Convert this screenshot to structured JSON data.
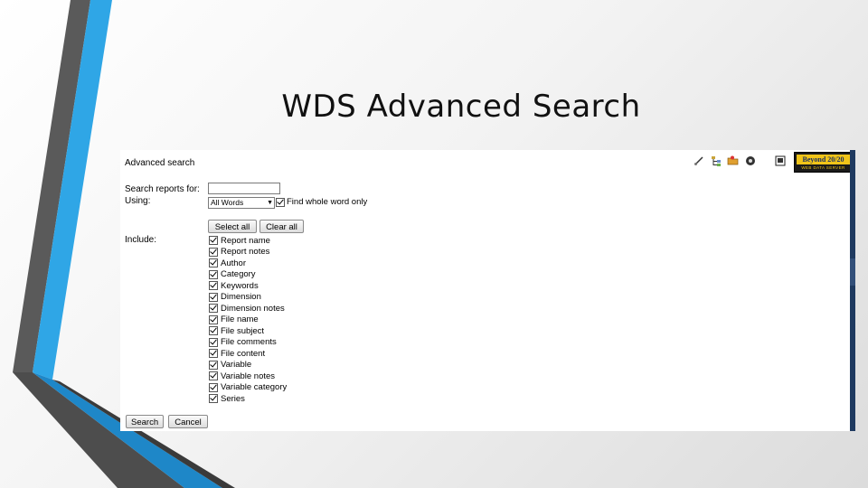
{
  "slide": {
    "title": "WDS Advanced Search"
  },
  "page": {
    "heading": "Advanced search",
    "search_label": "Search reports for:",
    "search_value": "",
    "using_label": "Using:",
    "using_selected": "All Words",
    "whole_word_label": "Find whole word only",
    "whole_word_checked": true,
    "select_all_label": "Select all",
    "clear_all_label": "Clear all",
    "include_label": "Include:",
    "include_items": [
      {
        "label": "Report name",
        "checked": true
      },
      {
        "label": "Report notes",
        "checked": true
      },
      {
        "label": "Author",
        "checked": true
      },
      {
        "label": "Category",
        "checked": true
      },
      {
        "label": "Keywords",
        "checked": true
      },
      {
        "label": "Dimension",
        "checked": true
      },
      {
        "label": "Dimension notes",
        "checked": true
      },
      {
        "label": "File name",
        "checked": true
      },
      {
        "label": "File subject",
        "checked": true
      },
      {
        "label": "File comments",
        "checked": true
      },
      {
        "label": "File content",
        "checked": true
      },
      {
        "label": "Variable",
        "checked": true
      },
      {
        "label": "Variable notes",
        "checked": true
      },
      {
        "label": "Variable category",
        "checked": true
      },
      {
        "label": "Series",
        "checked": true
      }
    ],
    "search_button": "Search",
    "cancel_button": "Cancel"
  },
  "toolbar": {
    "icons": [
      "edit-icon",
      "tree-icon",
      "folder-icon",
      "settings-icon",
      "report-icon",
      "help-icon"
    ]
  },
  "brand": {
    "name": "Beyond 20/20",
    "tagline": "WEB DATA SERVER"
  },
  "colors": {
    "accent_blue": "#29a3e0",
    "dark_gray": "#555555",
    "scroll_dark": "#1f3a60",
    "brand_yellow": "#f0c419"
  }
}
